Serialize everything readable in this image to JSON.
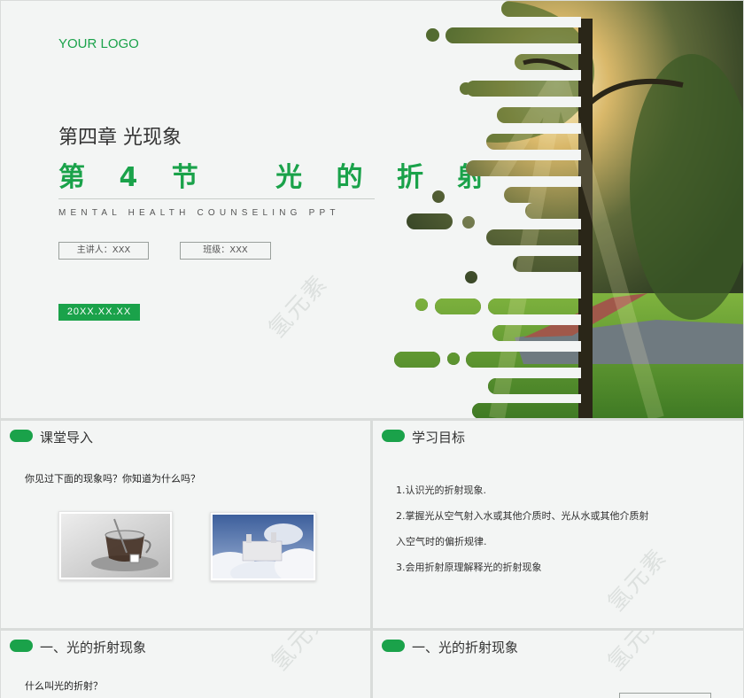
{
  "cover": {
    "logo": "YOUR LOGO",
    "chapter": "第四章 光现象",
    "title": "第 4 节   光 的 折 射",
    "subtitle": "MENTAL HEALTH COUNSELING PPT",
    "presenter_label": "主讲人：XXX",
    "class_label": "班级：XXX",
    "date": "20XX.XX.XX",
    "watermark": "氢元素",
    "image_icon": "sunlit-park-tree-photo"
  },
  "intro": {
    "title": "课堂导入",
    "question": "你见过下面的现象吗？你知道为什么吗？",
    "image_1_icon": "tea-cup-photo",
    "image_2_icon": "castle-in-clouds-photo"
  },
  "goals": {
    "title": "学习目标",
    "items": [
      "1.认识光的折射现象.",
      "2.掌握光从空气射入水或其他介质时、光从水或其他介质射",
      "入空气时的偏折规律.",
      "3.会用折射原理解释光的折射现象"
    ],
    "watermark": "氢元素"
  },
  "refraction_left": {
    "title": "一、光的折射现象",
    "question": "什么叫光的折射？",
    "watermark": "氢元素"
  },
  "refraction_right": {
    "title": "一、光的折射现象",
    "watermark": "氢元素"
  },
  "colors": {
    "accent": "#1aa24a",
    "background": "#f3f5f4"
  }
}
